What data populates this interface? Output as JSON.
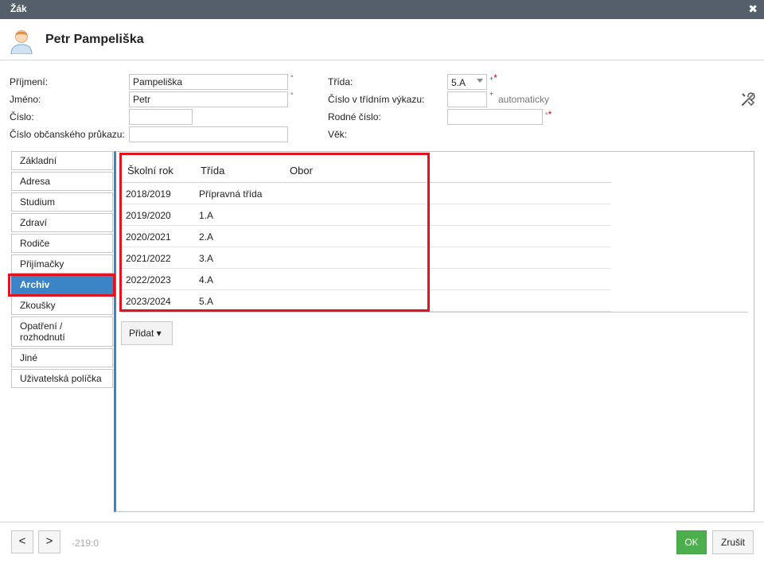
{
  "window": {
    "title": "Žák",
    "close_glyph": "✖"
  },
  "header": {
    "name": "Petr Pampeliška",
    "avatar_icon": "user-avatar-icon"
  },
  "form": {
    "prijmeni": {
      "label": "Příjmení:",
      "value": "Pampeliška"
    },
    "jmeno": {
      "label": "Jméno:",
      "value": "Petr"
    },
    "cislo": {
      "label": "Číslo:",
      "value": ""
    },
    "obcansky": {
      "label": "Číslo občanského průkazu:",
      "value": ""
    },
    "trida": {
      "label": "Třída:",
      "value": "5.A"
    },
    "cislo_vykaz": {
      "label": "Číslo v třídním výkazu:",
      "value": "",
      "note": "automaticky"
    },
    "rodne": {
      "label": "Rodné číslo:",
      "value": ""
    },
    "vek": {
      "label": "Věk:"
    },
    "mark_circle": "°",
    "mark_plus": "+",
    "mark_star": "*"
  },
  "sidebar": {
    "items": [
      {
        "label": "Základní"
      },
      {
        "label": "Adresa"
      },
      {
        "label": "Studium"
      },
      {
        "label": "Zdraví"
      },
      {
        "label": "Rodiče"
      },
      {
        "label": "Přijímačky"
      },
      {
        "label": "Archiv",
        "active": true
      },
      {
        "label": "Zkoušky"
      },
      {
        "label": "Opatření / rozhodnutí"
      },
      {
        "label": "Jiné"
      },
      {
        "label": "Uživatelská políčka"
      }
    ]
  },
  "archive": {
    "columns": [
      "Školní rok",
      "Třída",
      "Obor"
    ],
    "rows": [
      [
        "2018/2019",
        "Přípravná třída",
        ""
      ],
      [
        "2019/2020",
        "1.A",
        ""
      ],
      [
        "2020/2021",
        "2.A",
        ""
      ],
      [
        "2021/2022",
        "3.A",
        ""
      ],
      [
        "2022/2023",
        "4.A",
        ""
      ],
      [
        "2023/2024",
        "5.A",
        ""
      ]
    ],
    "add_button": "Přidat ▾"
  },
  "footer": {
    "prev": "<",
    "next": ">",
    "record": "-219:0",
    "ok": "OK",
    "cancel": "Zrušit"
  },
  "colors": {
    "accent": "#3b85c6",
    "ok": "#4cae4c",
    "highlight": "#e0141e",
    "titlebar": "#555f6b"
  }
}
